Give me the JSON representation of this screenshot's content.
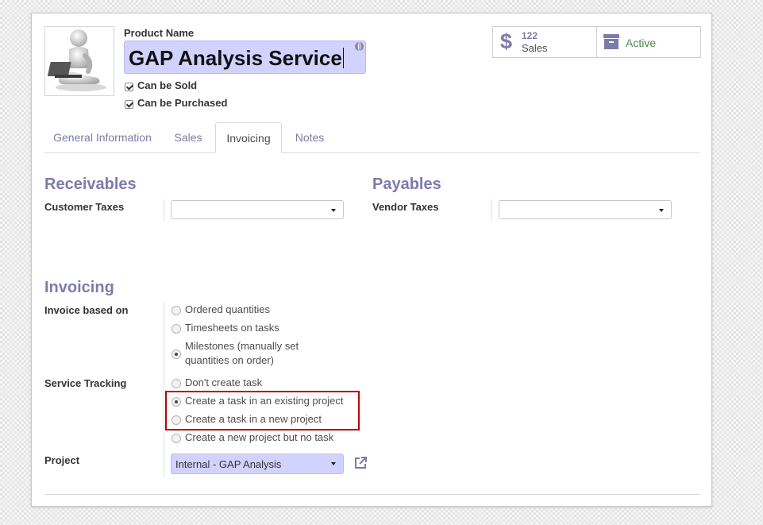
{
  "header": {
    "product_name_label": "Product Name",
    "product_name_value": "GAP Analysis Service",
    "can_be_sold_label": "Can be Sold",
    "can_be_purchased_label": "Can be Purchased",
    "can_be_sold_checked": true,
    "can_be_purchased_checked": true
  },
  "smart_buttons": {
    "sales_count": "122",
    "sales_label": "Sales",
    "active_label": "Active",
    "sales_icon": "dollar-icon",
    "active_icon": "archive-icon"
  },
  "tabs": [
    {
      "label": "General Information",
      "active": false
    },
    {
      "label": "Sales",
      "active": false
    },
    {
      "label": "Invoicing",
      "active": true
    },
    {
      "label": "Notes",
      "active": false
    }
  ],
  "receivables": {
    "title": "Receivables",
    "customer_taxes_label": "Customer Taxes",
    "customer_taxes_value": ""
  },
  "payables": {
    "title": "Payables",
    "vendor_taxes_label": "Vendor Taxes",
    "vendor_taxes_value": ""
  },
  "invoicing": {
    "title": "Invoicing",
    "invoice_based_on_label": "Invoice based on",
    "invoice_options": [
      {
        "label": "Ordered quantities",
        "checked": false
      },
      {
        "label": "Timesheets on tasks",
        "checked": false
      },
      {
        "label": "Milestones (manually set quantities on order)",
        "checked": true
      }
    ],
    "service_tracking_label": "Service Tracking",
    "tracking_options": [
      {
        "label": "Don't create task",
        "checked": false
      },
      {
        "label": "Create a task in an existing project",
        "checked": true
      },
      {
        "label": "Create a task in a new project",
        "checked": false
      },
      {
        "label": "Create a new project but no task",
        "checked": false
      }
    ],
    "project_label": "Project",
    "project_value": "Internal - GAP Analysis"
  },
  "colors": {
    "accent": "#7c7bad",
    "highlight_border": "#c00000",
    "input_required_bg": "#d2d2ff",
    "active_green": "#4a8a4a"
  }
}
